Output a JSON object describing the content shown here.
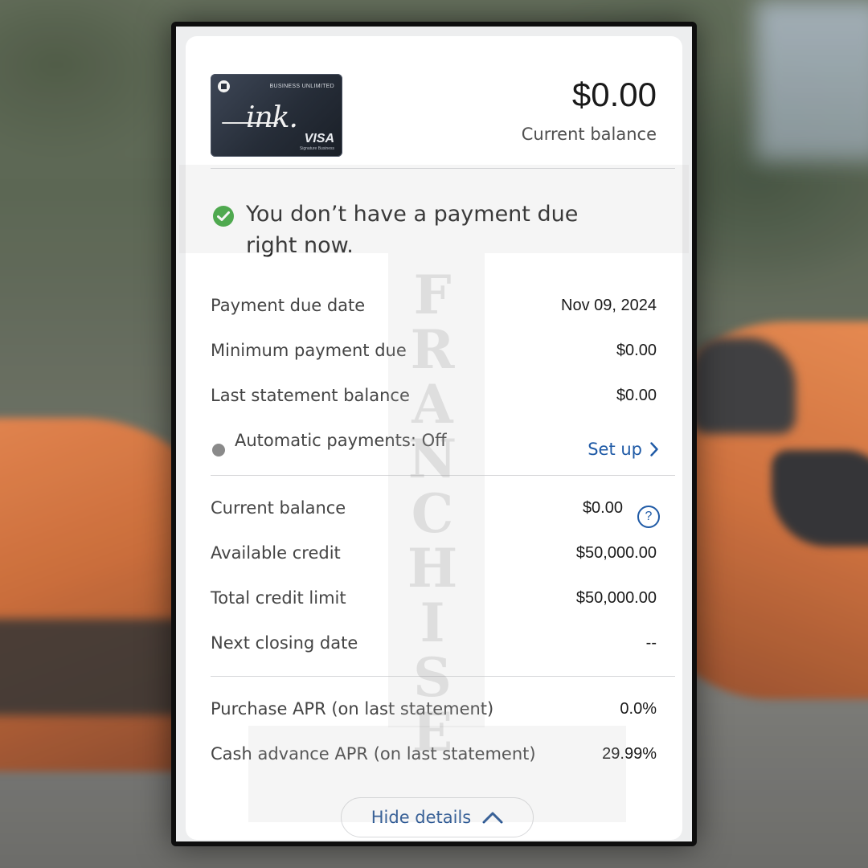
{
  "card": {
    "tier": "BUSINESS UNLIMITED",
    "brand_script": "ink.",
    "network": "VISA",
    "network_sub": "Signature Business"
  },
  "balance": {
    "amount": "$0.00",
    "label": "Current balance"
  },
  "status": {
    "message": "You don’t have a payment due right now.",
    "icon": "check-circle-icon",
    "color": "#3aa53a"
  },
  "payment_rows": [
    {
      "label": "Payment due date",
      "value": "Nov 09, 2024"
    },
    {
      "label": "Minimum payment due",
      "value": "$0.00"
    },
    {
      "label": "Last statement balance",
      "value": "$0.00"
    }
  ],
  "autopay": {
    "label": "Automatic payments: Off",
    "action": "Set up"
  },
  "credit_rows": [
    {
      "label": "Current balance",
      "value": "$0.00"
    },
    {
      "label": "Available credit",
      "value": "$50,000.00"
    },
    {
      "label": "Total credit limit",
      "value": "$50,000.00"
    },
    {
      "label": "Next closing date",
      "value": "--"
    }
  ],
  "help_icon_glyph": "?",
  "apr_rows": [
    {
      "label": "Purchase APR (on last statement)",
      "value": "0.0%"
    },
    {
      "label": "Cash advance APR (on last statement)",
      "value": "29.99%"
    }
  ],
  "footer": {
    "hide_details_label": "Hide details"
  },
  "watermark": {
    "text": "FRANCHISE"
  },
  "colors": {
    "link": "#1f5aa6",
    "success": "#3aa53a"
  }
}
